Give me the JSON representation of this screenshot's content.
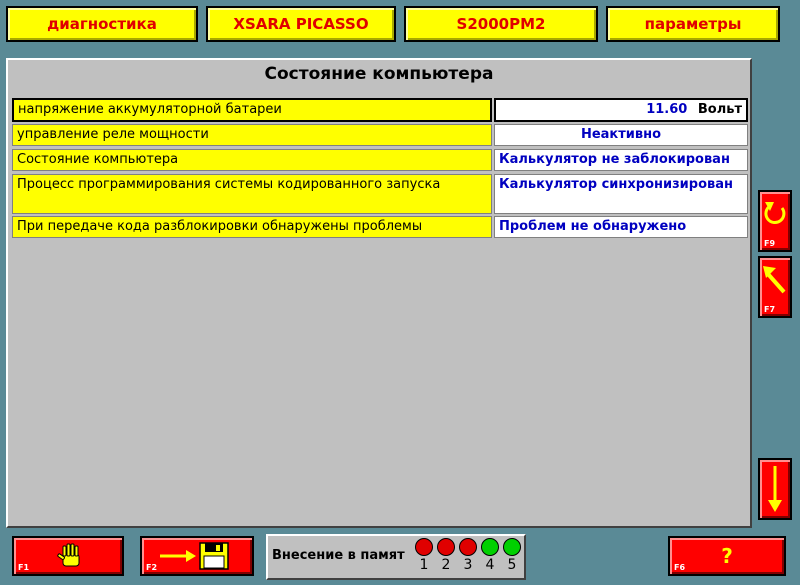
{
  "top_menu": [
    {
      "label": "диагностика"
    },
    {
      "label": "XSARA PICASSO"
    },
    {
      "label": "S2000PM2"
    },
    {
      "label": "параметры"
    }
  ],
  "main": {
    "title": "Состояние компьютера",
    "rows": [
      {
        "label": "напряжение аккумуляторной батареи",
        "value": "11.60",
        "unit": "Вольт"
      },
      {
        "label": "управление реле мощности",
        "value": "Неактивно"
      },
      {
        "label": "Состояние компьютера",
        "value": "Калькулятор не заблокирован"
      },
      {
        "label": "Процесс программирования системы кодированного запуска",
        "value": "Калькулятор синхронизирован"
      },
      {
        "label": "При передаче кода разблокировки обнаружены проблемы",
        "value": "Проблем не обнаружено"
      }
    ]
  },
  "side_buttons": [
    {
      "key": "F9",
      "icon": "undo-arrow-icon"
    },
    {
      "key": "F7",
      "icon": "arrow-up-left-icon"
    },
    {
      "key": "",
      "icon": "arrow-down-icon"
    }
  ],
  "bottom_buttons": {
    "f1": {
      "key": "F1",
      "icon": "hand-stop-icon"
    },
    "f2": {
      "key": "F2",
      "icon": "save-to-disk-icon"
    },
    "f6": {
      "key": "F6",
      "symbol": "?"
    }
  },
  "memory": {
    "label": "Внесение в памят",
    "slots": [
      {
        "num": "1",
        "color": "#e00000"
      },
      {
        "num": "2",
        "color": "#e00000"
      },
      {
        "num": "3",
        "color": "#e00000"
      },
      {
        "num": "4",
        "color": "#00d000"
      },
      {
        "num": "5",
        "color": "#00d000"
      }
    ]
  },
  "colors": {
    "menu_bg": "#ffff00",
    "menu_text": "#e00000",
    "label_bg": "#ffff00",
    "value_text": "#0000c0",
    "button_red": "#ff0000"
  }
}
